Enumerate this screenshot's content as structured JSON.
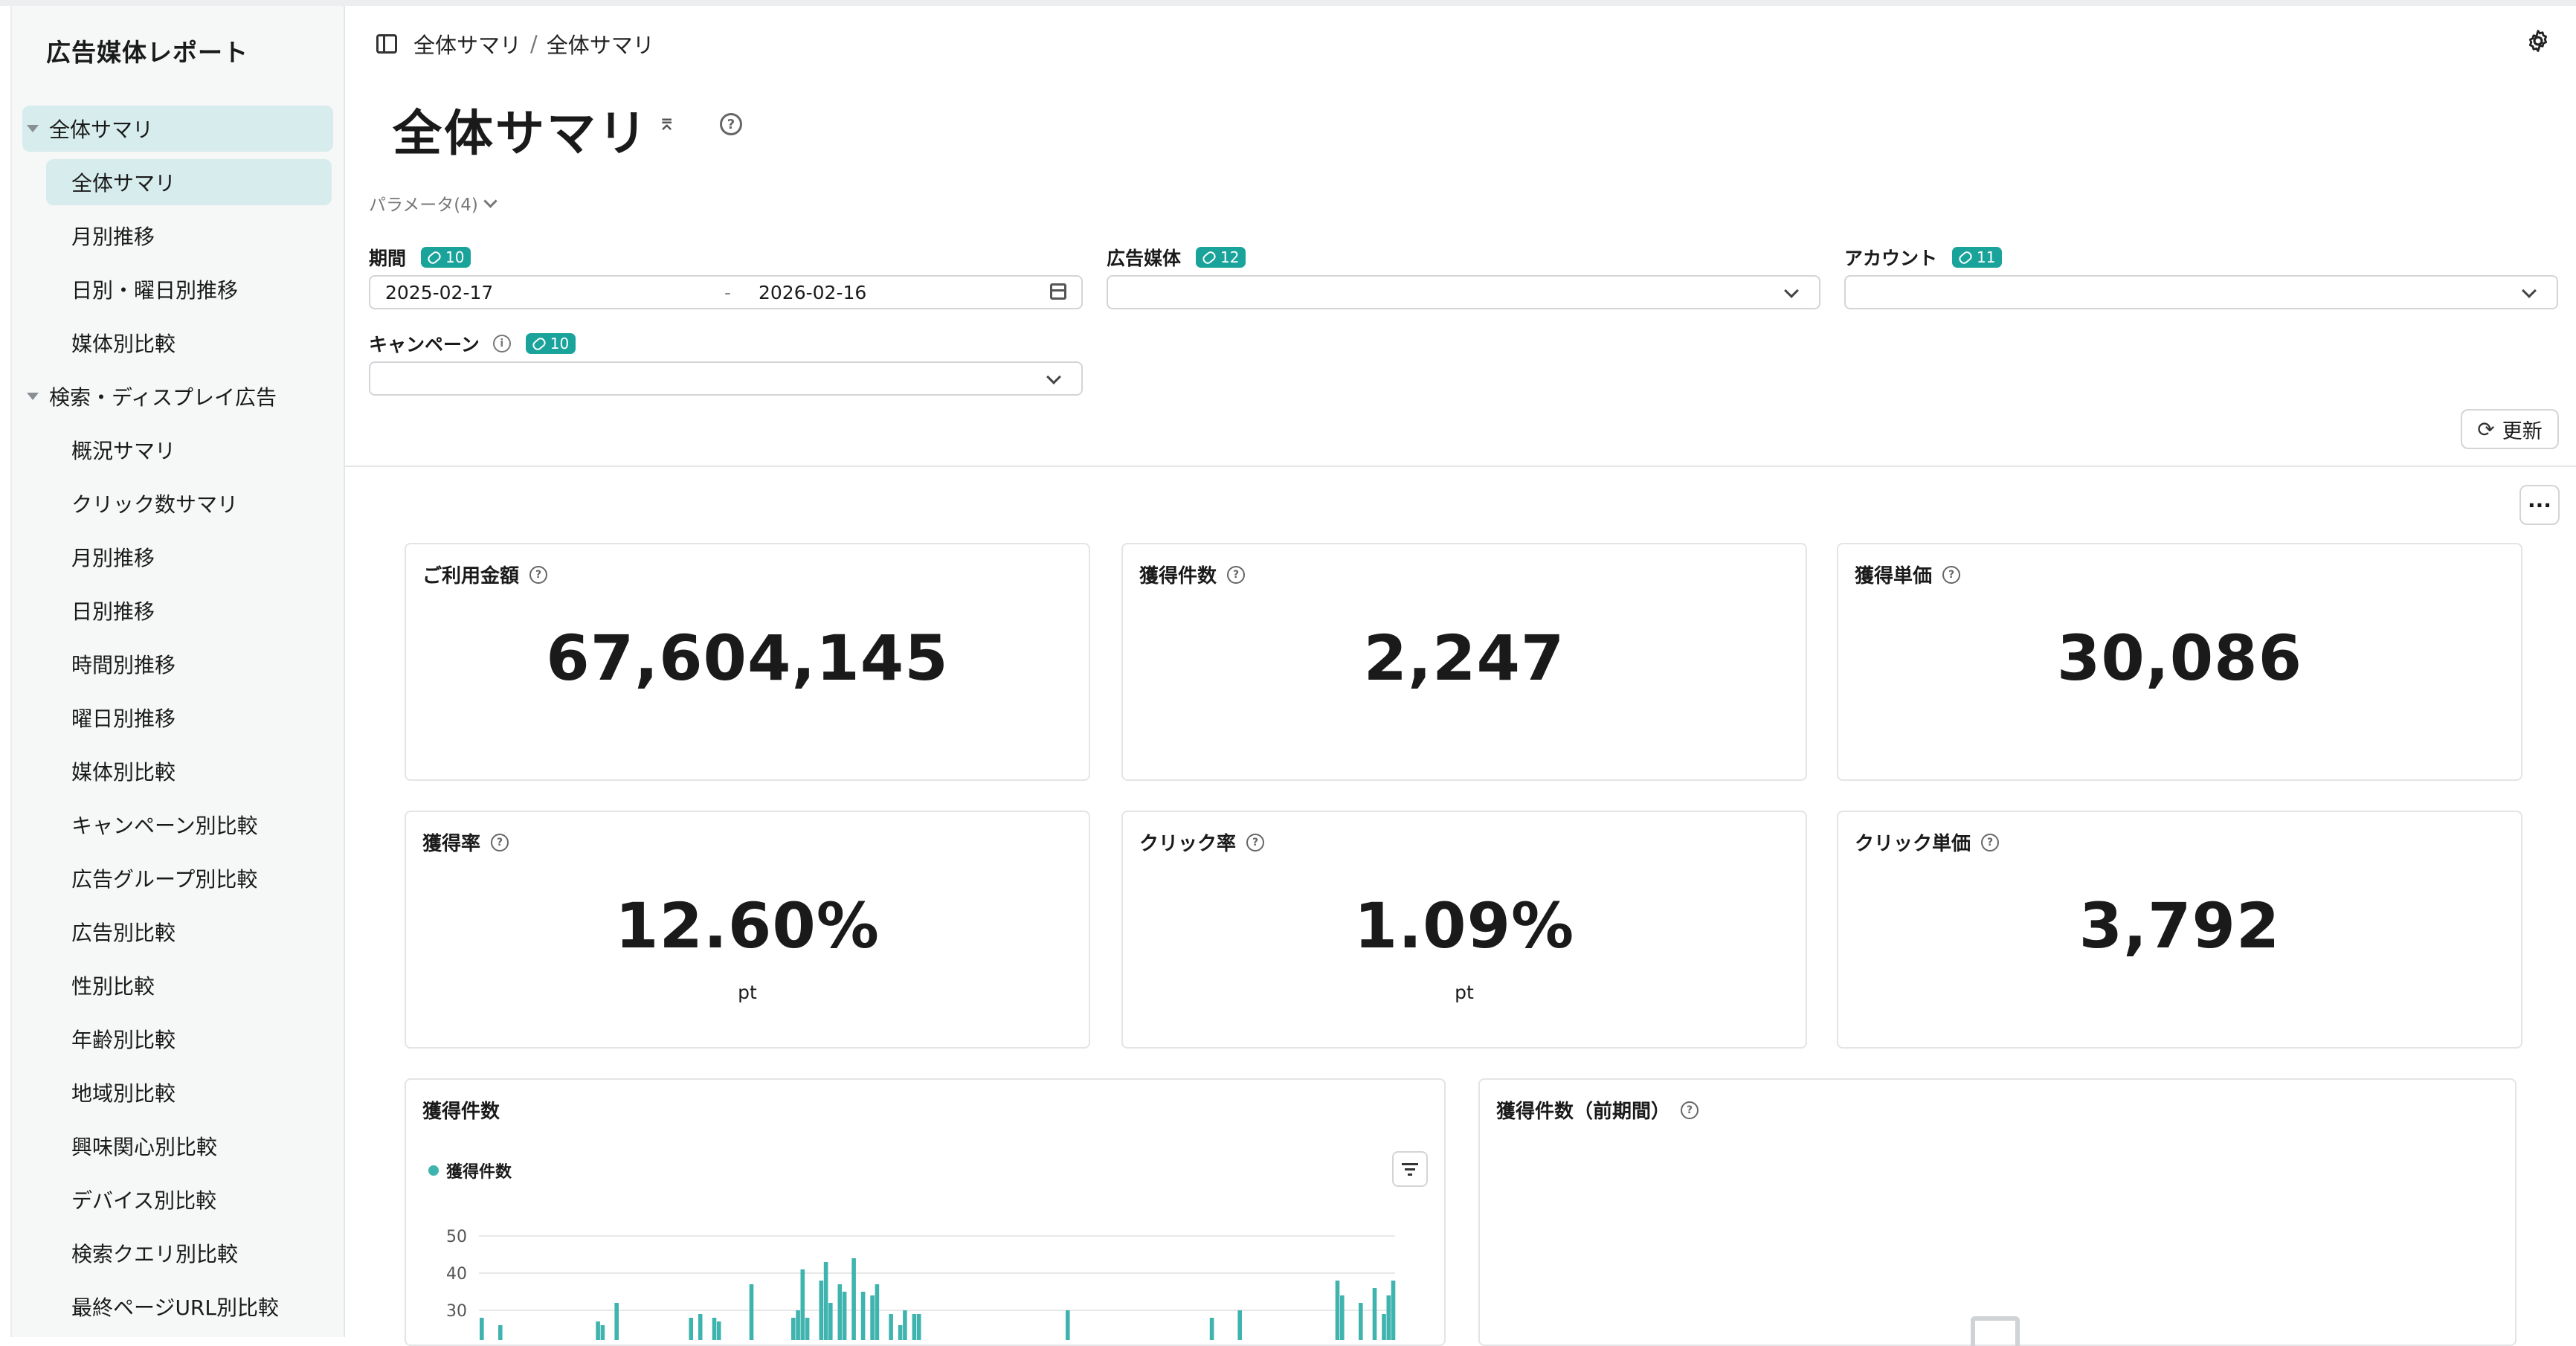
{
  "app": {
    "title": "広告媒体レポート"
  },
  "sidebar": {
    "items": [
      {
        "label": "全体サマリ",
        "kind": "group",
        "active": true
      },
      {
        "label": "全体サマリ",
        "kind": "item",
        "active": true
      },
      {
        "label": "月別推移",
        "kind": "item"
      },
      {
        "label": "日別・曜日別推移",
        "kind": "item"
      },
      {
        "label": "媒体別比較",
        "kind": "item"
      },
      {
        "label": "検索・ディスプレイ広告",
        "kind": "group"
      },
      {
        "label": "概況サマリ",
        "kind": "item"
      },
      {
        "label": "クリック数サマリ",
        "kind": "item"
      },
      {
        "label": "月別推移",
        "kind": "item"
      },
      {
        "label": "日別推移",
        "kind": "item"
      },
      {
        "label": "時間別推移",
        "kind": "item"
      },
      {
        "label": "曜日別推移",
        "kind": "item"
      },
      {
        "label": "媒体別比較",
        "kind": "item"
      },
      {
        "label": "キャンペーン別比較",
        "kind": "item"
      },
      {
        "label": "広告グループ別比較",
        "kind": "item"
      },
      {
        "label": "広告別比較",
        "kind": "item"
      },
      {
        "label": "性別比較",
        "kind": "item"
      },
      {
        "label": "年齢別比較",
        "kind": "item"
      },
      {
        "label": "地域別比較",
        "kind": "item"
      },
      {
        "label": "興味関心別比較",
        "kind": "item"
      },
      {
        "label": "デバイス別比較",
        "kind": "item"
      },
      {
        "label": "検索クエリ別比較",
        "kind": "item"
      },
      {
        "label": "最終ページURL別比較",
        "kind": "item"
      }
    ]
  },
  "header": {
    "breadcrumb": [
      "全体サマリ",
      "全体サマリ"
    ],
    "breadcrumb_sep": "/",
    "page_title": "全体サマリ"
  },
  "params": {
    "toggle_label": "パラメータ(4)",
    "period": {
      "label": "期間",
      "badge": "10",
      "start": "2025-02-17",
      "sep": "-",
      "end": "2026-02-16"
    },
    "media": {
      "label": "広告媒体",
      "badge": "12",
      "value": ""
    },
    "account": {
      "label": "アカウント",
      "badge": "11",
      "value": ""
    },
    "campaign": {
      "label": "キャンペーン",
      "badge": "10",
      "value": ""
    },
    "refresh_label": "更新",
    "more_label": "···"
  },
  "kpis": [
    {
      "title": "ご利用金額",
      "value": "67,604,145",
      "unit": ""
    },
    {
      "title": "獲得件数",
      "value": "2,247",
      "unit": ""
    },
    {
      "title": "獲得単価",
      "value": "30,086",
      "unit": ""
    },
    {
      "title": "獲得率",
      "value": "12.60%",
      "unit": "pt"
    },
    {
      "title": "クリック率",
      "value": "1.09%",
      "unit": "pt"
    },
    {
      "title": "クリック単価",
      "value": "3,792",
      "unit": ""
    }
  ],
  "charts": {
    "acquisitions": {
      "title": "獲得件数",
      "legend": "獲得件数"
    },
    "previous": {
      "title": "獲得件数（前期間）"
    }
  },
  "colors": {
    "accent": "#1aa39a",
    "bar": "#3fb3ae",
    "active_bg": "#d7ecec"
  },
  "chart_data": {
    "type": "bar",
    "series": [
      {
        "name": "獲得件数",
        "values": [
          28,
          0,
          0,
          0,
          26,
          0,
          0,
          0,
          0,
          0,
          0,
          0,
          0,
          0,
          0,
          0,
          0,
          0,
          0,
          0,
          0,
          0,
          0,
          0,
          0,
          27,
          26,
          0,
          0,
          32,
          0,
          0,
          0,
          0,
          0,
          0,
          0,
          0,
          0,
          0,
          0,
          0,
          0,
          0,
          0,
          28,
          0,
          29,
          0,
          0,
          28,
          27,
          0,
          0,
          0,
          0,
          0,
          0,
          37,
          0,
          0,
          0,
          0,
          0,
          0,
          0,
          0,
          28,
          30,
          41,
          28,
          0,
          0,
          38,
          43,
          32,
          0,
          37,
          35,
          0,
          44,
          0,
          35,
          0,
          34,
          37,
          0,
          0,
          29,
          0,
          26,
          30,
          0,
          29,
          29,
          0,
          0,
          0,
          0,
          0,
          0,
          0,
          0,
          0,
          0,
          0,
          0,
          0,
          0,
          0,
          0,
          0,
          0,
          0,
          0,
          0,
          0,
          0,
          0,
          0,
          0,
          0,
          0,
          0,
          0,
          0,
          30,
          0,
          0,
          0,
          0,
          0,
          0,
          0,
          0,
          0,
          0,
          0,
          0,
          0,
          0,
          0,
          0,
          0,
          0,
          0,
          0,
          0,
          0,
          0,
          0,
          0,
          0,
          0,
          0,
          0,
          0,
          28,
          0,
          0,
          0,
          0,
          0,
          30,
          0,
          0,
          0,
          0,
          0,
          0,
          0,
          0,
          0,
          0,
          0,
          0,
          0,
          0,
          0,
          0,
          0,
          0,
          0,
          0,
          38,
          34,
          0,
          0,
          0,
          32,
          0,
          0,
          36,
          0,
          29,
          34,
          38
        ]
      }
    ],
    "yticks": [
      30,
      40,
      50
    ],
    "ylim": [
      0,
      50
    ],
    "legend_position": "top-left"
  }
}
